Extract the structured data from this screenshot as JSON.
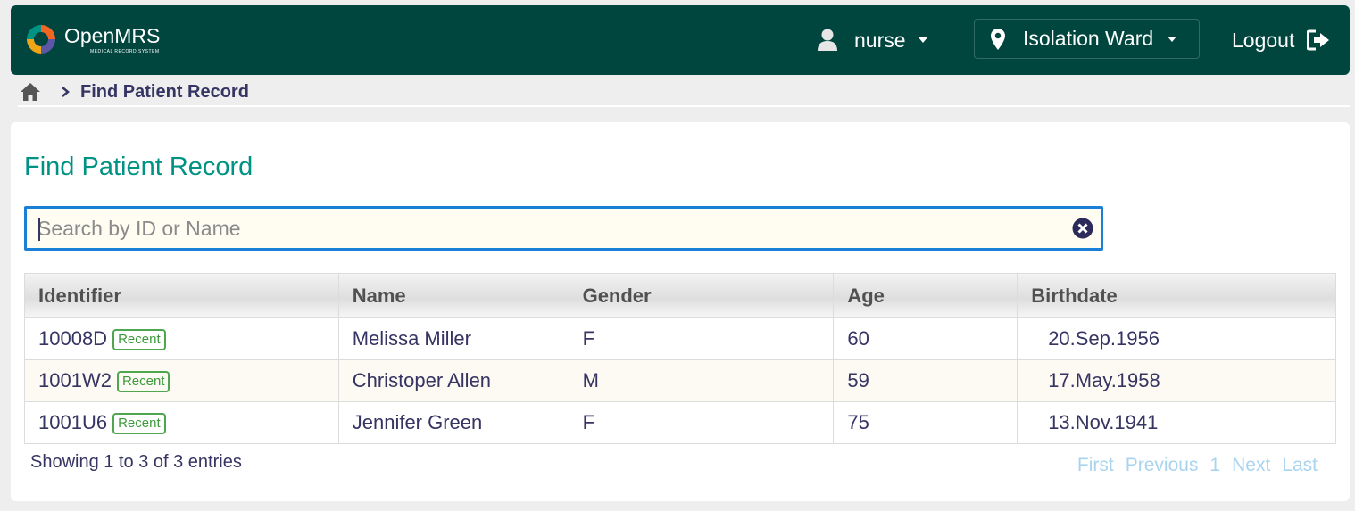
{
  "header": {
    "logo_text": "OpenMRS",
    "logo_subtext": "MEDICAL RECORD SYSTEM",
    "user": "nurse",
    "location": "Isolation Ward",
    "logout": "Logout",
    "colors": {
      "background": "#00463f",
      "text": "#ffffff"
    }
  },
  "breadcrumb": {
    "current": "Find Patient Record"
  },
  "main": {
    "title": "Find Patient Record",
    "search": {
      "placeholder": "Search by ID or Name",
      "value": ""
    },
    "table": {
      "columns": [
        "Identifier",
        "Name",
        "Gender",
        "Age",
        "Birthdate"
      ],
      "rows": [
        {
          "identifier": "10008D",
          "badge": "Recent",
          "name": "Melissa Miller",
          "gender": "F",
          "age": "60",
          "birthdate": "20.Sep.1956"
        },
        {
          "identifier": "1001W2",
          "badge": "Recent",
          "name": "Christoper Allen",
          "gender": "M",
          "age": "59",
          "birthdate": "17.May.1958"
        },
        {
          "identifier": "1001U6",
          "badge": "Recent",
          "name": "Jennifer Green",
          "gender": "F",
          "age": "75",
          "birthdate": "13.Nov.1941"
        }
      ]
    },
    "info": "Showing 1 to 3 of 3 entries",
    "pagination": {
      "first": "First",
      "previous": "Previous",
      "page": "1",
      "next": "Next",
      "last": "Last"
    },
    "colors": {
      "title": "#009384",
      "search_border": "#1a7fd6",
      "badge": "#4ea64e",
      "pager": "#a9d4ef"
    }
  },
  "icons": [
    "openmrs-logo-icon",
    "user-icon",
    "location-pin-icon",
    "logout-icon",
    "home-icon",
    "chevron-right-icon",
    "clear-search-icon"
  ]
}
